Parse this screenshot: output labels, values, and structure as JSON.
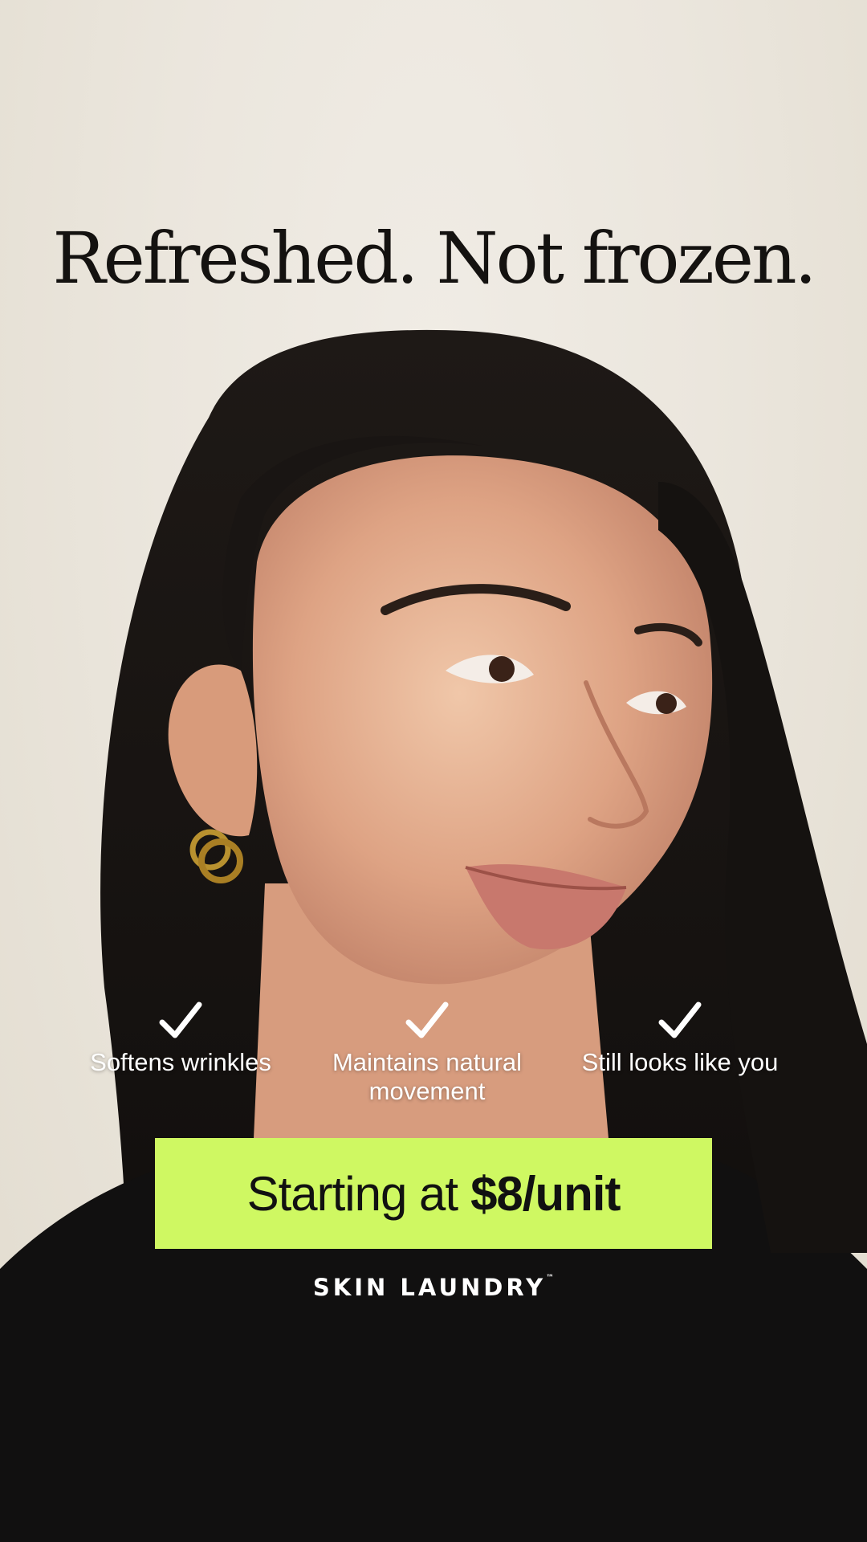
{
  "headline": "Refreshed. Not frozen.",
  "features": [
    {
      "icon": "checkmark-icon",
      "label": "Softens wrinkles"
    },
    {
      "icon": "checkmark-icon",
      "label": "Maintains natural movement"
    },
    {
      "icon": "checkmark-icon",
      "label": "Still looks like you"
    }
  ],
  "cta": {
    "prefix": "Starting at",
    "price": "$8/unit"
  },
  "brand": {
    "name": "SKIN LAUNDRY",
    "mark": "™"
  },
  "colors": {
    "cta_background": "#cff862",
    "background": "#ebe6dd",
    "headline_text": "#141210",
    "shirt": "#111111"
  }
}
